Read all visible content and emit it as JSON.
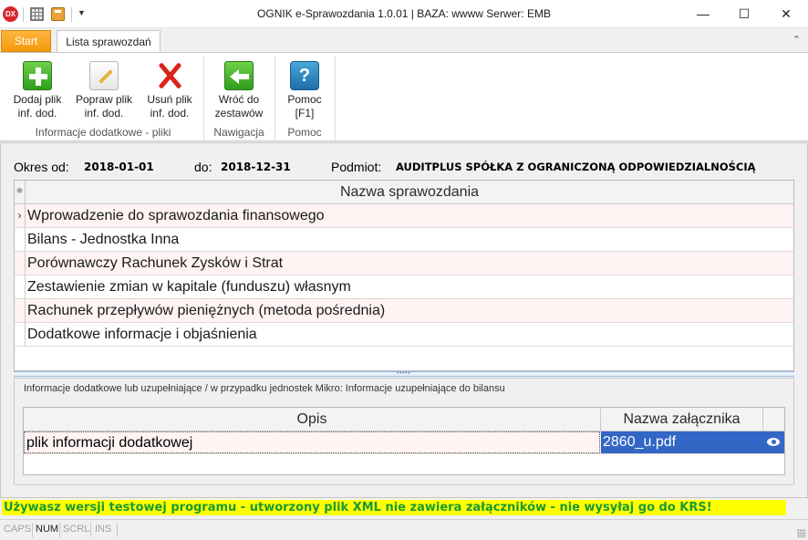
{
  "window": {
    "title": "OGNIK e-Sprawozdania 1.0.01 | BAZA: wwww Serwer: EMB",
    "app_icon_text": "DX",
    "minimize": "—",
    "maximize": "☐",
    "close": "✕"
  },
  "tabs": {
    "start": "Start",
    "lista": "Lista sprawozdań"
  },
  "ribbon": {
    "groups": [
      {
        "label": "Informacje dodatkowe - pliki",
        "buttons": [
          {
            "line1": "Dodaj plik",
            "line2": "inf. dod."
          },
          {
            "line1": "Popraw plik",
            "line2": "inf. dod."
          },
          {
            "line1": "Usuń plik",
            "line2": "inf. dod."
          }
        ]
      },
      {
        "label": "Nawigacja",
        "buttons": [
          {
            "line1": "Wróć do",
            "line2": "zestawów"
          }
        ]
      },
      {
        "label": "Pomoc",
        "buttons": [
          {
            "line1": "Pomoc",
            "line2": "[F1]"
          }
        ]
      }
    ]
  },
  "header": {
    "okres_label": "Okres od:",
    "okres_od": "2018-01-01",
    "do_label": "do:",
    "okres_do": "2018-12-31",
    "podmiot_label": "Podmiot:",
    "podmiot": "AUDITPLUS SPÓŁKA Z OGRANICZONĄ ODPOWIEDZIALNOŚCIĄ"
  },
  "reports_grid": {
    "header_indicator": "✱",
    "column": "Nazwa sprawozdania",
    "current_row_indicator": "›",
    "rows": [
      "Wprowadzenie do sprawozdania finansowego",
      "Bilans - Jednostka Inna",
      "Porównawczy Rachunek Zysków i Strat",
      "Zestawienie zmian w kapitale (funduszu) własnym",
      "Rachunek przepływów pieniężnych (metoda pośrednia)",
      "Dodatkowe informacje i objaśnienia"
    ]
  },
  "attachments": {
    "panel_label": "Informacje dodatkowe lub uzupełniające / w przypadku jednostek Mikro: Informacje uzupełniające do bilansu",
    "col_opis": "Opis",
    "col_nazwa": "Nazwa załącznika",
    "rows": [
      {
        "opis": "plik informacji dodatkowej",
        "nazwa": "2860_u.pdf"
      }
    ]
  },
  "warning": "Używasz wersji testowej programu - utworzony plik XML nie zawiera załączników - nie wysyłaj go do KRS!",
  "statusbar": {
    "caps": "CAPS",
    "num": "NUM",
    "scrl": "SCRL",
    "ins": "INS"
  },
  "colors": {
    "start_tab": "#f39a0a",
    "selection": "#3367c6",
    "warning_bg": "#ffff00",
    "warning_text": "#1a9a32",
    "row_alt": "#fff3f3"
  }
}
